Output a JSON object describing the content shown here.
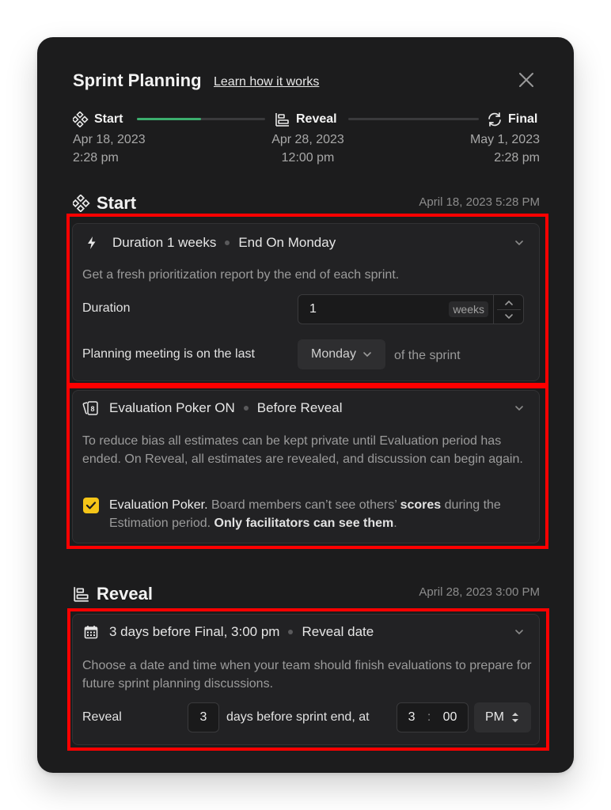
{
  "header": {
    "title": "Sprint Planning",
    "learn_link": "Learn how it works",
    "close_icon": "close-icon"
  },
  "stepper": {
    "progress": 0.5,
    "steps": [
      {
        "label": "Start",
        "icon": "diamond-grid-icon",
        "date": "Apr 18, 2023",
        "time": "2:28 pm"
      },
      {
        "label": "Reveal",
        "icon": "bar-align-icon",
        "date": "Apr 28, 2023",
        "time": "12:00 pm"
      },
      {
        "label": "Final",
        "icon": "refresh-icon",
        "date": "May 1, 2023",
        "time": "2:28 pm"
      }
    ]
  },
  "start_section": {
    "title": "Start",
    "timestamp": "April 18, 2023 5:28 PM",
    "duration_card": {
      "head_part1": "Duration 1 weeks",
      "head_part2": "End On Monday",
      "description": "Get a fresh prioritization report by the end of each sprint.",
      "duration_label": "Duration",
      "duration_value": "1",
      "duration_unit": "weeks",
      "meeting_label": "Planning meeting is on the last",
      "meeting_day": "Monday",
      "meeting_suffix": "of the sprint"
    },
    "poker_card": {
      "head_part1": "Evaluation Poker ON",
      "head_part2": "Before Reveal",
      "description": "To reduce bias all estimates can be kept private until Evaluation period has ended. On Reveal, all estimates are revealed, and discussion can begin again.",
      "checkbox_checked": true,
      "check_title": "Evaluation Poker.",
      "check_text_1": " Board members can’t see others’ ",
      "check_bold_1": "scores",
      "check_text_2": " during the Estimation period. ",
      "check_bold_2": "Only facilitators can see them",
      "check_text_3": "."
    }
  },
  "reveal_section": {
    "title": "Reveal",
    "timestamp": "April 28, 2023 3:00 PM",
    "card": {
      "head_part1": "3 days before Final, 3:00 pm",
      "head_part2": "Reveal date",
      "description": "Choose a date and time when your team should finish evaluations to prepare for future sprint planning discussions.",
      "reveal_label": "Reveal",
      "days_value": "3",
      "days_suffix": "days before sprint end, at",
      "hour": "3",
      "colon": ":",
      "minute": "00",
      "ampm": "PM"
    }
  },
  "colors": {
    "background": "#1c1c1d",
    "accent_progress": "#3cae6e",
    "checkbox": "#f5c518",
    "highlight": "#ff0000"
  }
}
